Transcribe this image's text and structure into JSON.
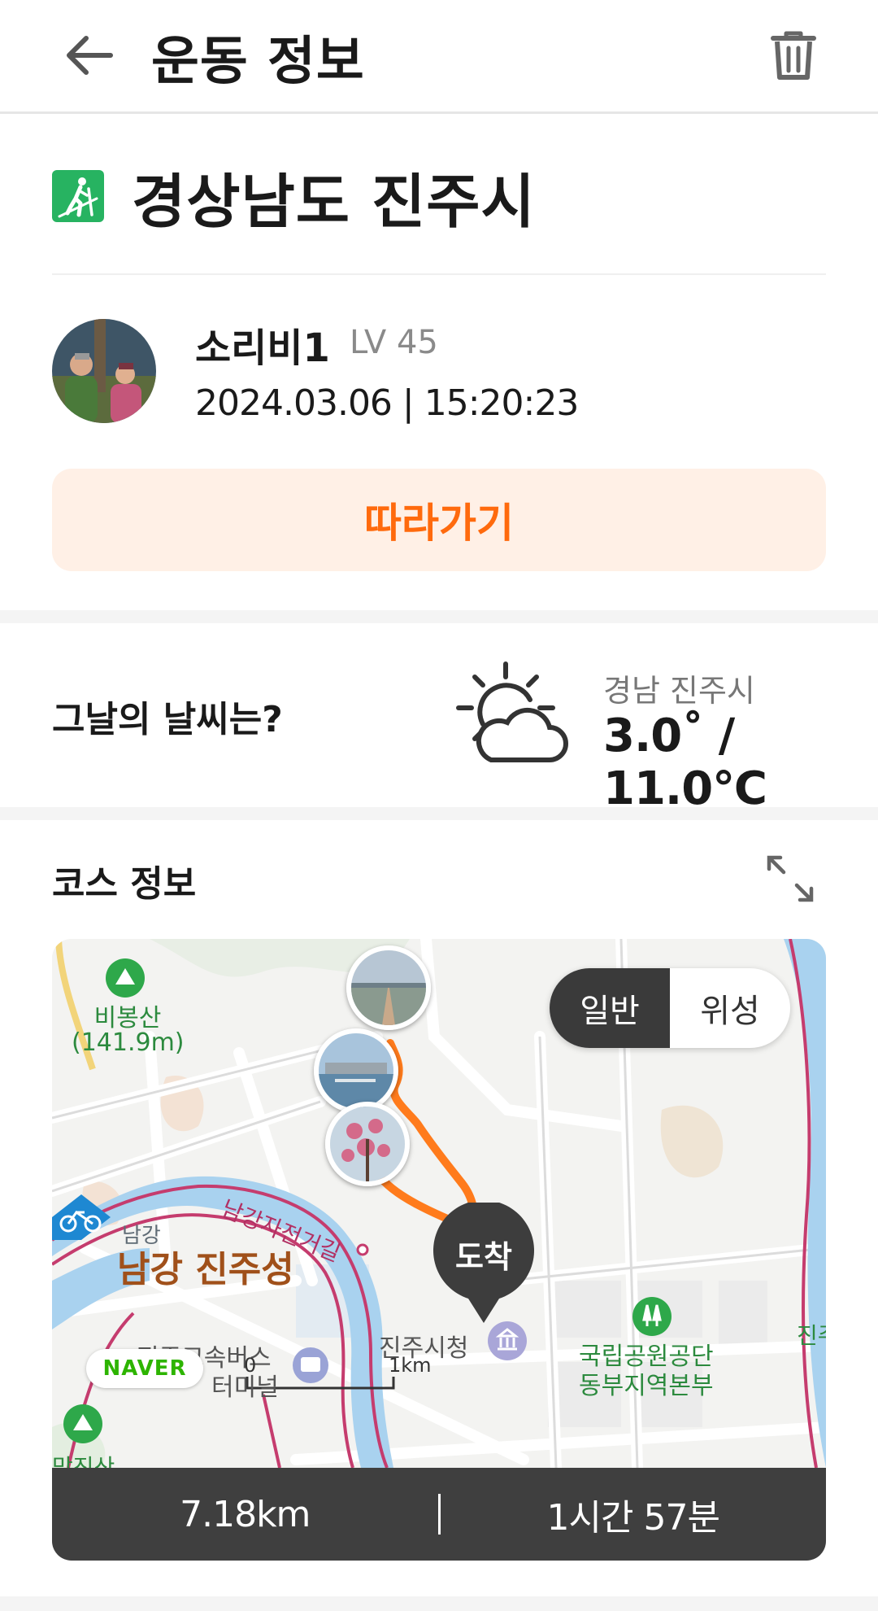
{
  "header": {
    "title": "운동 정보",
    "back_icon": "arrow-left-icon",
    "delete_icon": "trash-icon"
  },
  "activity": {
    "icon": "hiking-icon",
    "location": "경상남도 진주시"
  },
  "user": {
    "name": "소리비1",
    "level": "LV 45",
    "datetime": "2024.03.06 | 15:20:23"
  },
  "follow_button": {
    "label": "따라가기",
    "color": "#ff6a0d"
  },
  "weather": {
    "question": "그날의 날씨는?",
    "icon": "partly-cloudy-icon",
    "region": "경남 진주시",
    "temperature": "3.0˚ / 11.0℃"
  },
  "course": {
    "title": "코스 정보",
    "expand_icon": "expand-icon",
    "map": {
      "toggle": {
        "normal": "일반",
        "satellite": "위성"
      },
      "arrival_label": "도착",
      "brand": "NAVER",
      "labels": {
        "mountain1_name": "비봉산",
        "mountain1_height": "(141.9m)",
        "river_small": "남강",
        "castle": "남강 진주성",
        "bike_road": "남강자전거길",
        "bus_terminal_1": "진주고속버스",
        "bus_terminal_2": "터미널",
        "city_hall": "진주시청",
        "park_office_1": "국립공원공단",
        "park_office_2": "동부지역본부",
        "edge_label": "진주",
        "mountain2_name": "망진산",
        "scale_zero": "0",
        "scale_km": "1km"
      }
    },
    "distance": "7.18km",
    "duration": "1시간 57분"
  }
}
